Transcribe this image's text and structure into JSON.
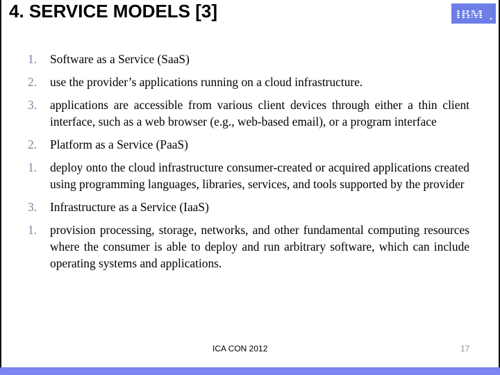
{
  "slide": {
    "title": "4. SERVICE MODELS [3]",
    "logo": {
      "icon": "ibm-logo",
      "text": "IBM",
      "background": "#6c7ee8"
    },
    "items": [
      {
        "number": "1.",
        "text": "Software as a Service (SaaS)"
      },
      {
        "number": "2.",
        "text": "use the provider’s applications running on a cloud infrastructure."
      },
      {
        "number": "3.",
        "text": "applications are accessible from various client devices through either a thin client interface, such as a web browser (e.g., web-based email), or a program interface"
      },
      {
        "number": "2.",
        "text": "Platform as a Service (PaaS)"
      },
      {
        "number": "1.",
        "text": "deploy onto the cloud infrastructure consumer-created or acquired applications created using programming languages, libraries, services, and tools supported by the provider"
      },
      {
        "number": "3.",
        "text": "Infrastructure as a Service (IaaS)"
      },
      {
        "number": "1.",
        "text": "provision processing, storage, networks, and other fundamental computing resources where the consumer is able to deploy and run arbitrary software, which can include operating systems and applications."
      }
    ],
    "footer": {
      "center": "ICA CON 2012",
      "page_number": "17"
    },
    "colors": {
      "band": "#7b86f2",
      "number": "#7d83a6"
    }
  }
}
